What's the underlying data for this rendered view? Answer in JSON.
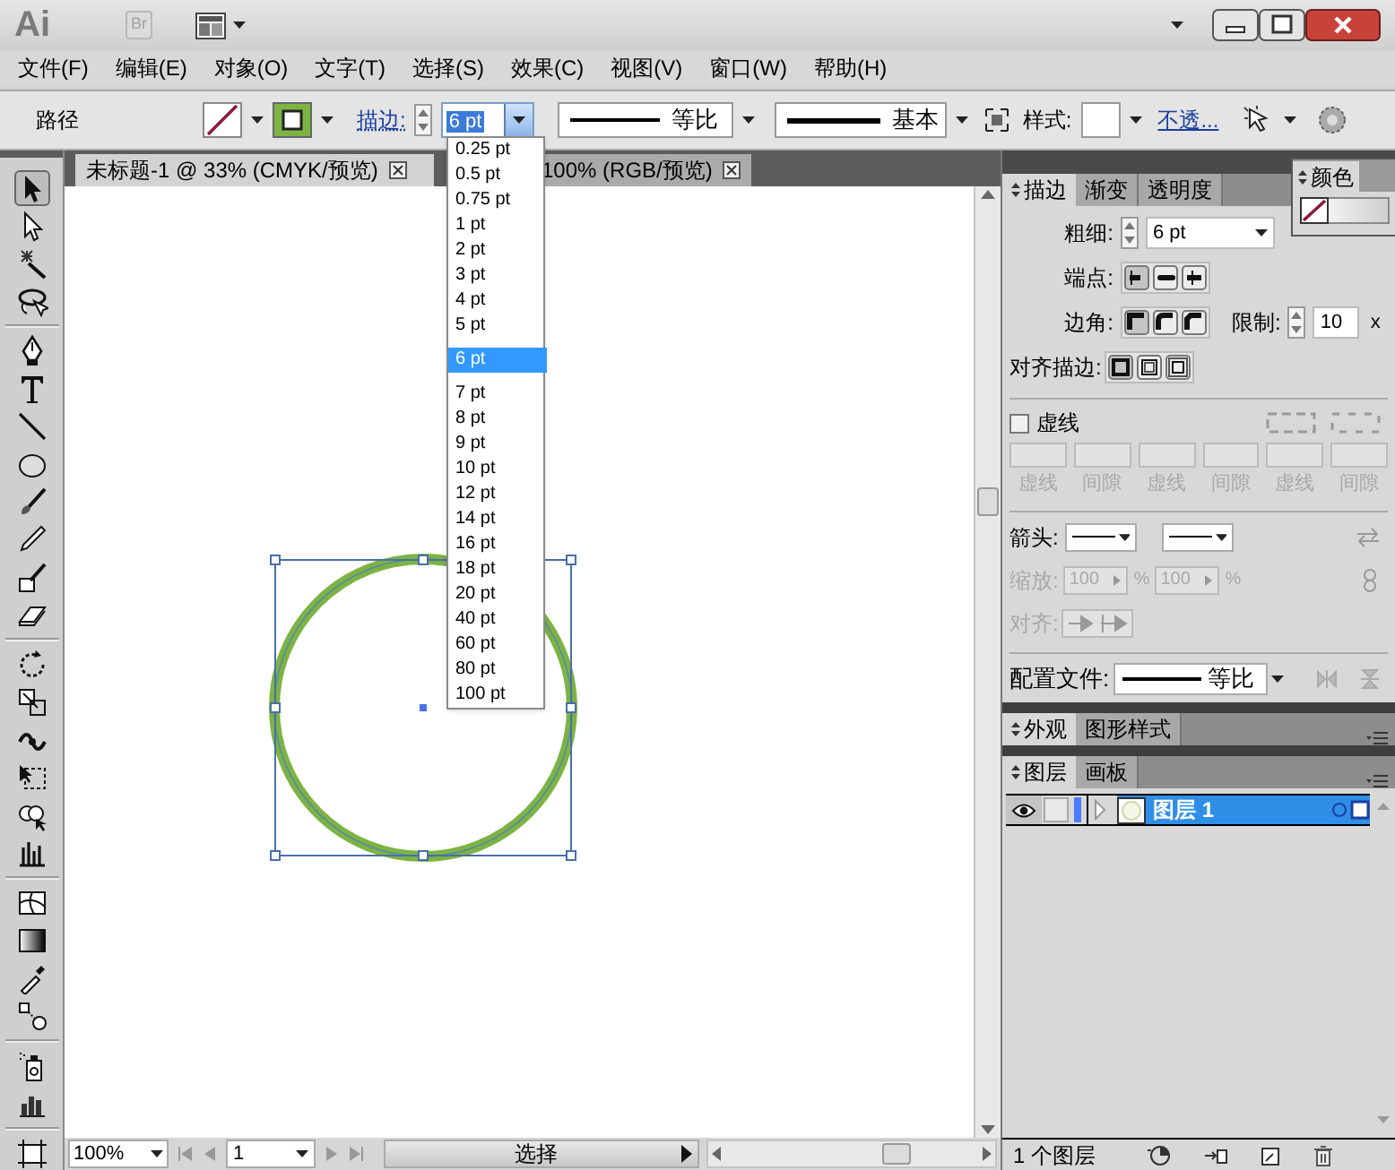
{
  "title_bar": {
    "app": "Ai",
    "bridge": "Br"
  },
  "menu": [
    {
      "label": "文件(F)"
    },
    {
      "label": "编辑(E)"
    },
    {
      "label": "对象(O)"
    },
    {
      "label": "文字(T)"
    },
    {
      "label": "选择(S)"
    },
    {
      "label": "效果(C)"
    },
    {
      "label": "视图(V)"
    },
    {
      "label": "窗口(W)"
    },
    {
      "label": "帮助(H)"
    }
  ],
  "control_bar": {
    "selection": "路径",
    "stroke_label": "描边:",
    "stroke_weight": "6 pt",
    "profile": "等比",
    "brush": "基本",
    "style_label": "样式:",
    "opacity_link": "不透..."
  },
  "stroke_weight_dropdown": {
    "options": [
      {
        "label": "0.25 pt",
        "selected": false
      },
      {
        "label": "0.5 pt",
        "selected": false
      },
      {
        "label": "0.75 pt",
        "selected": false
      },
      {
        "label": "1 pt",
        "selected": false
      },
      {
        "label": "2 pt",
        "selected": false
      },
      {
        "label": "3 pt",
        "selected": false
      },
      {
        "label": "4 pt",
        "selected": false
      },
      {
        "label": "5 pt",
        "selected": false
      },
      {
        "label": "6 pt",
        "selected": true
      },
      {
        "label": "7 pt",
        "selected": false
      },
      {
        "label": "8 pt",
        "selected": false
      },
      {
        "label": "9 pt",
        "selected": false
      },
      {
        "label": "10 pt",
        "selected": false
      },
      {
        "label": "12 pt",
        "selected": false
      },
      {
        "label": "14 pt",
        "selected": false
      },
      {
        "label": "16 pt",
        "selected": false
      },
      {
        "label": "18 pt",
        "selected": false
      },
      {
        "label": "20 pt",
        "selected": false
      },
      {
        "label": "40 pt",
        "selected": false
      },
      {
        "label": "60 pt",
        "selected": false
      },
      {
        "label": "80 pt",
        "selected": false
      },
      {
        "label": "100 pt",
        "selected": false
      }
    ]
  },
  "documents": [
    {
      "title": "未标题-1 @ 33% (CMYK/预览)",
      "selected": true
    },
    {
      "title": "100% (RGB/预览)",
      "selected": false
    }
  ],
  "stroke_panel": {
    "tabs": [
      {
        "label": "描边",
        "selected": true
      },
      {
        "label": "渐变",
        "selected": false
      },
      {
        "label": "透明度",
        "selected": false
      }
    ],
    "weight_label": "粗细:",
    "weight": "6 pt",
    "cap_label": "端点:",
    "corner_label": "边角:",
    "limit_label": "限制:",
    "limit": "10",
    "limit_unit": "x",
    "align_label": "对齐描边:",
    "dashed": {
      "label": "虚线",
      "checked": false
    },
    "dash_fields": [
      "虚线",
      "间隙",
      "虚线",
      "间隙",
      "虚线",
      "间隙"
    ],
    "arrowheads_label": "箭头:",
    "scale_label": "缩放:",
    "scale": [
      "100",
      "100"
    ],
    "percent": "%",
    "arrow_align_label": "对齐:",
    "profile_label": "配置文件:",
    "profile": "等比"
  },
  "color_panel": {
    "tabs": [
      {
        "label": "颜色",
        "selected": true
      }
    ]
  },
  "appearance_tabs": [
    {
      "label": "外观",
      "selected": true
    },
    {
      "label": "图形样式",
      "selected": false
    }
  ],
  "layers_tabs": [
    {
      "label": "图层",
      "selected": true
    },
    {
      "label": "画板",
      "selected": false
    }
  ],
  "layers": [
    {
      "name": "图层 1",
      "selected": true,
      "visible": true,
      "color": "#4f7cff"
    }
  ],
  "layers_footer": "1 个图层",
  "status_bar": {
    "zoom": "100%",
    "artboard": "1",
    "tool": "选择"
  }
}
